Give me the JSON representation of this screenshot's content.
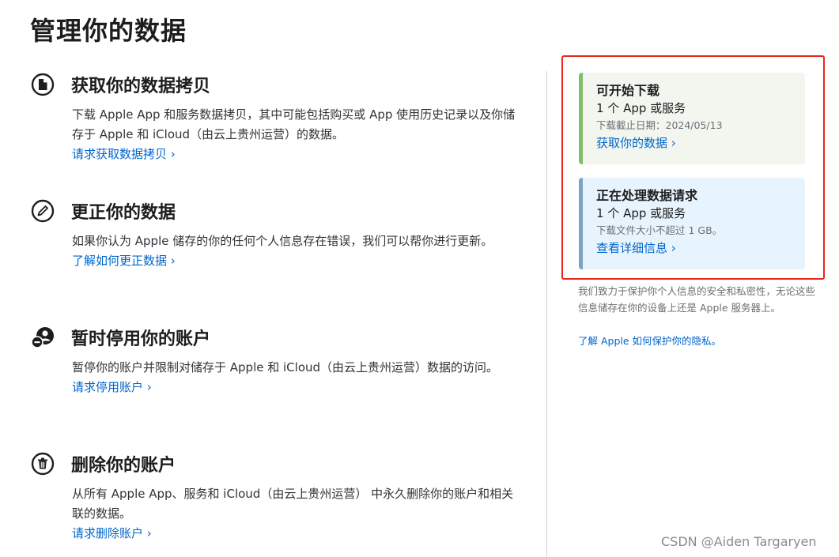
{
  "page": {
    "title": "管理你的数据"
  },
  "sections": [
    {
      "icon": "document-icon",
      "title": "获取你的数据拷贝",
      "desc": "下载 Apple App 和服务数据拷贝，其中可能包括购买或 App 使用历史记录以及你储存于 Apple 和 iCloud（由云上贵州运营）的数据。",
      "link": "请求获取数据拷贝 ›"
    },
    {
      "icon": "pencil-icon",
      "title": "更正你的数据",
      "desc": "如果你认为 Apple 储存的你的任何个人信息存在错误，我们可以帮你进行更新。",
      "link": "了解如何更正数据 ›"
    },
    {
      "icon": "deactivate-account-icon",
      "title": "暂时停用你的账户",
      "desc": "暂停你的账户并限制对储存于 Apple 和 iCloud（由云上贵州运营）数据的访问。",
      "link": "请求停用账户 ›"
    },
    {
      "icon": "trash-icon",
      "title": "删除你的账户",
      "desc": "从所有 Apple App、服务和 iCloud（由云上贵州运营） 中永久删除你的账户和相关联的数据。",
      "link": "请求删除账户 ›"
    }
  ],
  "sidebar": {
    "ready_card": {
      "title": "可开始下载",
      "subtitle": "1 个 App 或服务",
      "note": "下载截止日期：2024/05/13",
      "link": "获取你的数据 ›"
    },
    "processing_card": {
      "title": "正在处理数据请求",
      "subtitle": "1 个 App 或服务",
      "note": "下载文件大小不超过 1 GB。",
      "link": "查看详细信息 ›"
    },
    "privacy_note": "我们致力于保护你个人信息的安全和私密性，无论这些信息储存在你的设备上还是 Apple 服务器上。",
    "privacy_link": "了解 Apple 如何保护你的隐私。"
  },
  "watermark": "CSDN @Aiden Targaryen",
  "colors": {
    "link": "#0066cc",
    "highlight_border": "#e8251f",
    "ready_bg": "#f2f6ef",
    "ready_accent": "#7fbf6b",
    "processing_bg": "#e8f4fd",
    "processing_accent": "#7aa3c6"
  }
}
